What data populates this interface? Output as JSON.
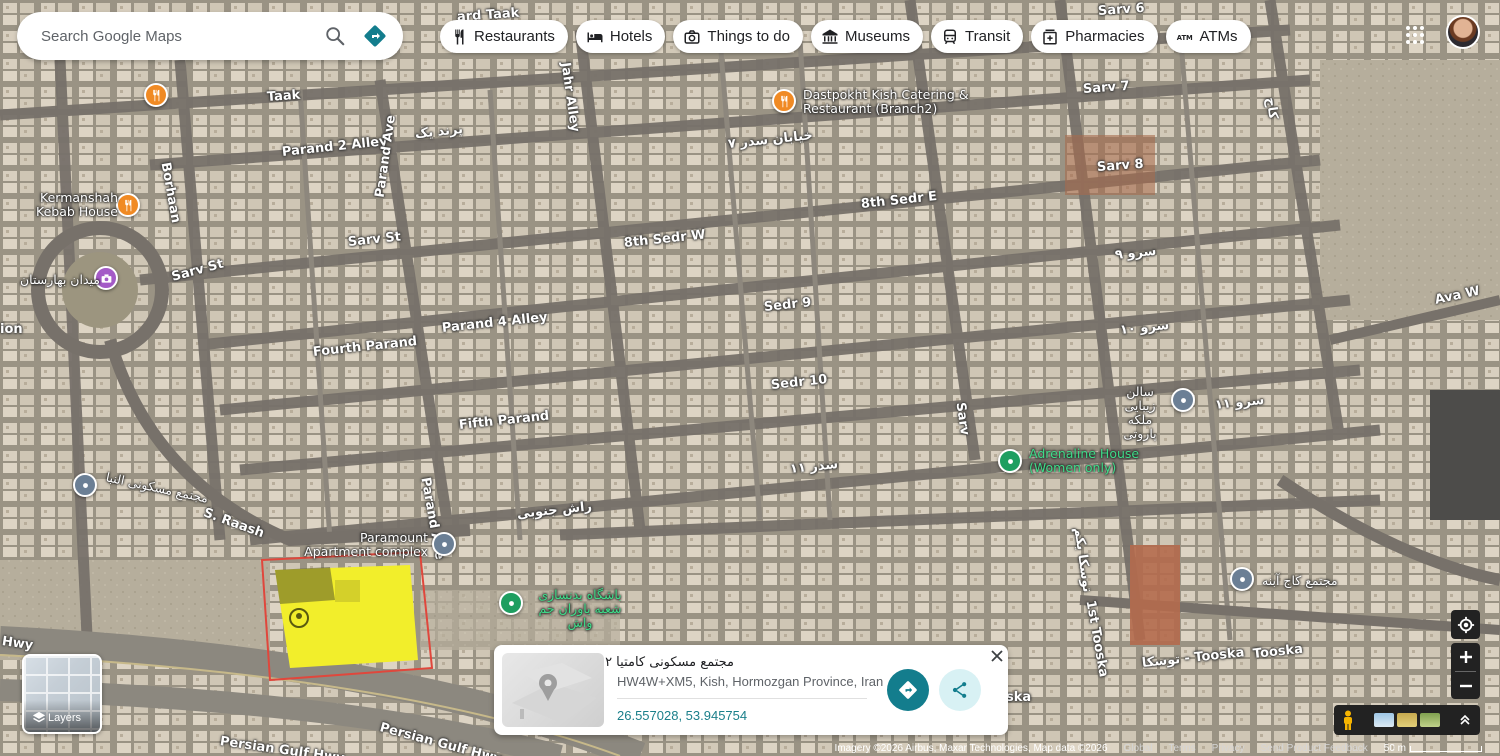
{
  "search": {
    "placeholder": "Search Google Maps"
  },
  "chips": [
    {
      "label": "Restaurants",
      "icon": "fork-knife-icon"
    },
    {
      "label": "Hotels",
      "icon": "bed-icon"
    },
    {
      "label": "Things to do",
      "icon": "camera-icon"
    },
    {
      "label": "Museums",
      "icon": "museum-icon"
    },
    {
      "label": "Transit",
      "icon": "train-icon"
    },
    {
      "label": "Pharmacies",
      "icon": "pharmacy-icon"
    },
    {
      "label": "ATMs",
      "icon": "atm-icon"
    }
  ],
  "map": {
    "street_labels": [
      "Taak",
      "Sarv 6",
      "Sarv 7",
      "Sarv 8",
      "Sarv St",
      "Sarv St",
      "Parand 2 Alley",
      "Parand Ave",
      "Borhaan",
      "8th Sedr W",
      "8th Sedr E",
      "Sedr 9",
      "Sedr 10",
      "Parand 4 Alley",
      "Fourth Parand",
      "Fifth Parand",
      "Parand Ave",
      "S. Raash",
      "Sarv",
      "Ava W",
      "1st Tooska",
      "Tooska",
      "Persian Gulf Hwy",
      "Persian Gulf Hwy",
      "Hwy",
      "ska",
      "ion",
      "Jahr Alley",
      "ard Taak",
      "پرند یک",
      "خیابان سدر ۷",
      "سرو ۹",
      "سرو ۱۰",
      "سرو ۱۱",
      "سدر ۱۱",
      "راش جنوبی",
      "توسکا یکم",
      "توسکا - Tooska",
      "کاج"
    ],
    "places": [
      {
        "name": "Dastpokht Kish Catering & Restaurant (Branch2)",
        "type": "restaurant"
      },
      {
        "name": "Kermanshah Kebab House",
        "type": "restaurant"
      },
      {
        "name": "میدان بهارستان",
        "type": "landmark"
      },
      {
        "name": "سالن زیبایی ملکه پاروتی",
        "type": "salon"
      },
      {
        "name": "Adrenaline House (Women only)",
        "type": "gym"
      },
      {
        "name": "مجتمع مسکونی النبا",
        "type": "residential"
      },
      {
        "name": "Paramount Apartment complex",
        "type": "residential"
      },
      {
        "name": "باشگاه بدنسازی شعبه یاوران جم واش",
        "type": "gym"
      },
      {
        "name": "مجتمع کاج آبنه",
        "type": "residential"
      }
    ]
  },
  "card": {
    "title": "مجتمع مسکونی کامتیا ۲",
    "address": "HW4W+XM5, Kish, Hormozgan Province, Iran",
    "coordinates": "26.557028, 53.945754"
  },
  "layers": {
    "label": "Layers"
  },
  "attribution": {
    "imagery": "Imagery ©2026 Airbus, Maxar Technologies, Map data ©2026",
    "global": "Global",
    "terms": "Terms",
    "privacy": "Privacy",
    "feedback": "Send Product Feedback",
    "scale": "50 m"
  },
  "colors": {
    "accent": "#137d8d",
    "selected_area": "#f2ee2b"
  }
}
